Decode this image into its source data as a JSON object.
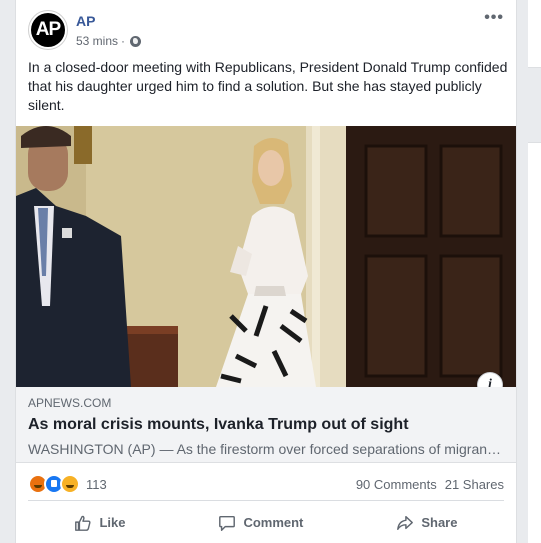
{
  "post": {
    "page_name": "AP",
    "avatar_text": "AP",
    "timestamp": "53 mins",
    "separator": "·",
    "more_label": "•••",
    "text": "In a closed-door meeting with Republicans, President Donald Trump confided that his daughter urged him to find a solution. But she has stayed publicly silent.",
    "info_label": "i"
  },
  "link": {
    "domain": "APNEWS.COM",
    "title": "As moral crisis mounts, Ivanka Trump out of sight",
    "description": "WASHINGTON (AP) — As the firestorm over forced separations of migrant children at the border grows, Ivanka Trump has stayed silent."
  },
  "stats": {
    "reaction_icons": [
      "angry-reaction",
      "like-reaction",
      "haha-reaction"
    ],
    "reaction_count": "113",
    "comments": "90 Comments",
    "shares": "21 Shares"
  },
  "actions": {
    "like": "Like",
    "comment": "Comment",
    "share": "Share"
  },
  "colors": {
    "link_blue": "#385898",
    "secondary_text": "#606770",
    "background": "#e9ebee",
    "link_box": "#f2f3f5"
  }
}
